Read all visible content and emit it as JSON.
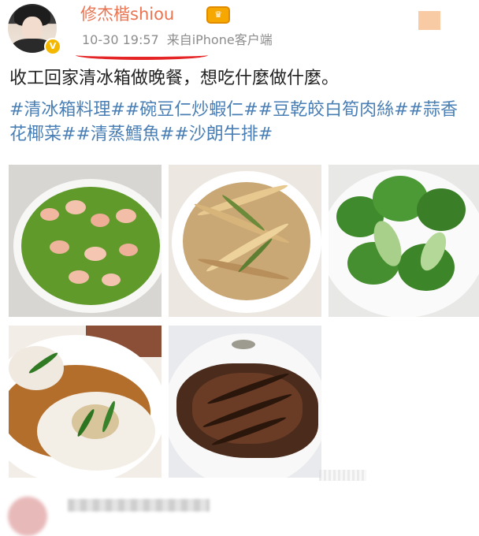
{
  "post": {
    "username": "修杰楷shiou",
    "time": "10-30 19:57",
    "source": "来自iPhone客户端",
    "text": "收工回家清冰箱做晚餐，想吃什麼做什麼。",
    "tags": [
      "#清冰箱料理#",
      "#碗豆仁炒蝦仁#",
      "#豆乾皎白筍肉絲#",
      "#蒜香花椰菜#",
      "#清蒸鱈魚#",
      "#沙朗牛排#"
    ],
    "photos": [
      "peas-and-shrimp-photo",
      "tofu-and-bamboo-shoot-photo",
      "garlic-broccoli-photo",
      "steamed-cod-photo",
      "sirloin-steak-photo"
    ]
  },
  "colors": {
    "username": "#eb7350",
    "tag": "#4a7fb5",
    "underline": "#e52525",
    "meta": "#8c8c8c"
  },
  "icons": {
    "verified_badge": "V",
    "vip_icon": "vip-crown-icon"
  }
}
